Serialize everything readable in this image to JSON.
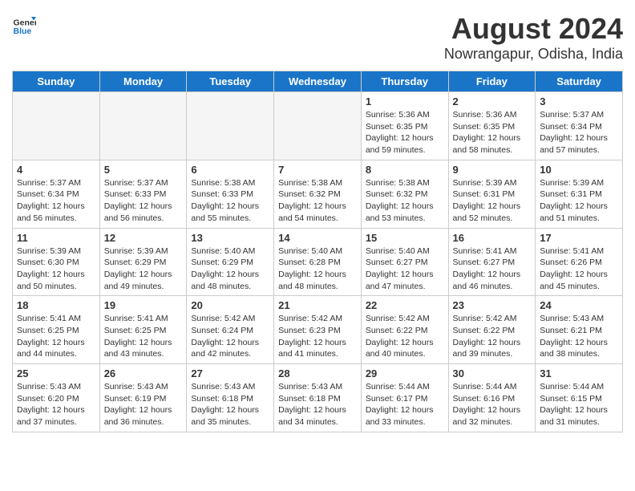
{
  "header": {
    "logo_line1": "General",
    "logo_line2": "Blue",
    "month_year": "August 2024",
    "location": "Nowrangapur, Odisha, India"
  },
  "weekdays": [
    "Sunday",
    "Monday",
    "Tuesday",
    "Wednesday",
    "Thursday",
    "Friday",
    "Saturday"
  ],
  "weeks": [
    [
      {
        "day": "",
        "info": "",
        "empty": true
      },
      {
        "day": "",
        "info": "",
        "empty": true
      },
      {
        "day": "",
        "info": "",
        "empty": true
      },
      {
        "day": "",
        "info": "",
        "empty": true
      },
      {
        "day": "1",
        "info": "Sunrise: 5:36 AM\nSunset: 6:35 PM\nDaylight: 12 hours\nand 59 minutes.",
        "empty": false
      },
      {
        "day": "2",
        "info": "Sunrise: 5:36 AM\nSunset: 6:35 PM\nDaylight: 12 hours\nand 58 minutes.",
        "empty": false
      },
      {
        "day": "3",
        "info": "Sunrise: 5:37 AM\nSunset: 6:34 PM\nDaylight: 12 hours\nand 57 minutes.",
        "empty": false
      }
    ],
    [
      {
        "day": "4",
        "info": "Sunrise: 5:37 AM\nSunset: 6:34 PM\nDaylight: 12 hours\nand 56 minutes.",
        "empty": false
      },
      {
        "day": "5",
        "info": "Sunrise: 5:37 AM\nSunset: 6:33 PM\nDaylight: 12 hours\nand 56 minutes.",
        "empty": false
      },
      {
        "day": "6",
        "info": "Sunrise: 5:38 AM\nSunset: 6:33 PM\nDaylight: 12 hours\nand 55 minutes.",
        "empty": false
      },
      {
        "day": "7",
        "info": "Sunrise: 5:38 AM\nSunset: 6:32 PM\nDaylight: 12 hours\nand 54 minutes.",
        "empty": false
      },
      {
        "day": "8",
        "info": "Sunrise: 5:38 AM\nSunset: 6:32 PM\nDaylight: 12 hours\nand 53 minutes.",
        "empty": false
      },
      {
        "day": "9",
        "info": "Sunrise: 5:39 AM\nSunset: 6:31 PM\nDaylight: 12 hours\nand 52 minutes.",
        "empty": false
      },
      {
        "day": "10",
        "info": "Sunrise: 5:39 AM\nSunset: 6:31 PM\nDaylight: 12 hours\nand 51 minutes.",
        "empty": false
      }
    ],
    [
      {
        "day": "11",
        "info": "Sunrise: 5:39 AM\nSunset: 6:30 PM\nDaylight: 12 hours\nand 50 minutes.",
        "empty": false
      },
      {
        "day": "12",
        "info": "Sunrise: 5:39 AM\nSunset: 6:29 PM\nDaylight: 12 hours\nand 49 minutes.",
        "empty": false
      },
      {
        "day": "13",
        "info": "Sunrise: 5:40 AM\nSunset: 6:29 PM\nDaylight: 12 hours\nand 48 minutes.",
        "empty": false
      },
      {
        "day": "14",
        "info": "Sunrise: 5:40 AM\nSunset: 6:28 PM\nDaylight: 12 hours\nand 48 minutes.",
        "empty": false
      },
      {
        "day": "15",
        "info": "Sunrise: 5:40 AM\nSunset: 6:27 PM\nDaylight: 12 hours\nand 47 minutes.",
        "empty": false
      },
      {
        "day": "16",
        "info": "Sunrise: 5:41 AM\nSunset: 6:27 PM\nDaylight: 12 hours\nand 46 minutes.",
        "empty": false
      },
      {
        "day": "17",
        "info": "Sunrise: 5:41 AM\nSunset: 6:26 PM\nDaylight: 12 hours\nand 45 minutes.",
        "empty": false
      }
    ],
    [
      {
        "day": "18",
        "info": "Sunrise: 5:41 AM\nSunset: 6:25 PM\nDaylight: 12 hours\nand 44 minutes.",
        "empty": false
      },
      {
        "day": "19",
        "info": "Sunrise: 5:41 AM\nSunset: 6:25 PM\nDaylight: 12 hours\nand 43 minutes.",
        "empty": false
      },
      {
        "day": "20",
        "info": "Sunrise: 5:42 AM\nSunset: 6:24 PM\nDaylight: 12 hours\nand 42 minutes.",
        "empty": false
      },
      {
        "day": "21",
        "info": "Sunrise: 5:42 AM\nSunset: 6:23 PM\nDaylight: 12 hours\nand 41 minutes.",
        "empty": false
      },
      {
        "day": "22",
        "info": "Sunrise: 5:42 AM\nSunset: 6:22 PM\nDaylight: 12 hours\nand 40 minutes.",
        "empty": false
      },
      {
        "day": "23",
        "info": "Sunrise: 5:42 AM\nSunset: 6:22 PM\nDaylight: 12 hours\nand 39 minutes.",
        "empty": false
      },
      {
        "day": "24",
        "info": "Sunrise: 5:43 AM\nSunset: 6:21 PM\nDaylight: 12 hours\nand 38 minutes.",
        "empty": false
      }
    ],
    [
      {
        "day": "25",
        "info": "Sunrise: 5:43 AM\nSunset: 6:20 PM\nDaylight: 12 hours\nand 37 minutes.",
        "empty": false
      },
      {
        "day": "26",
        "info": "Sunrise: 5:43 AM\nSunset: 6:19 PM\nDaylight: 12 hours\nand 36 minutes.",
        "empty": false
      },
      {
        "day": "27",
        "info": "Sunrise: 5:43 AM\nSunset: 6:18 PM\nDaylight: 12 hours\nand 35 minutes.",
        "empty": false
      },
      {
        "day": "28",
        "info": "Sunrise: 5:43 AM\nSunset: 6:18 PM\nDaylight: 12 hours\nand 34 minutes.",
        "empty": false
      },
      {
        "day": "29",
        "info": "Sunrise: 5:44 AM\nSunset: 6:17 PM\nDaylight: 12 hours\nand 33 minutes.",
        "empty": false
      },
      {
        "day": "30",
        "info": "Sunrise: 5:44 AM\nSunset: 6:16 PM\nDaylight: 12 hours\nand 32 minutes.",
        "empty": false
      },
      {
        "day": "31",
        "info": "Sunrise: 5:44 AM\nSunset: 6:15 PM\nDaylight: 12 hours\nand 31 minutes.",
        "empty": false
      }
    ]
  ]
}
